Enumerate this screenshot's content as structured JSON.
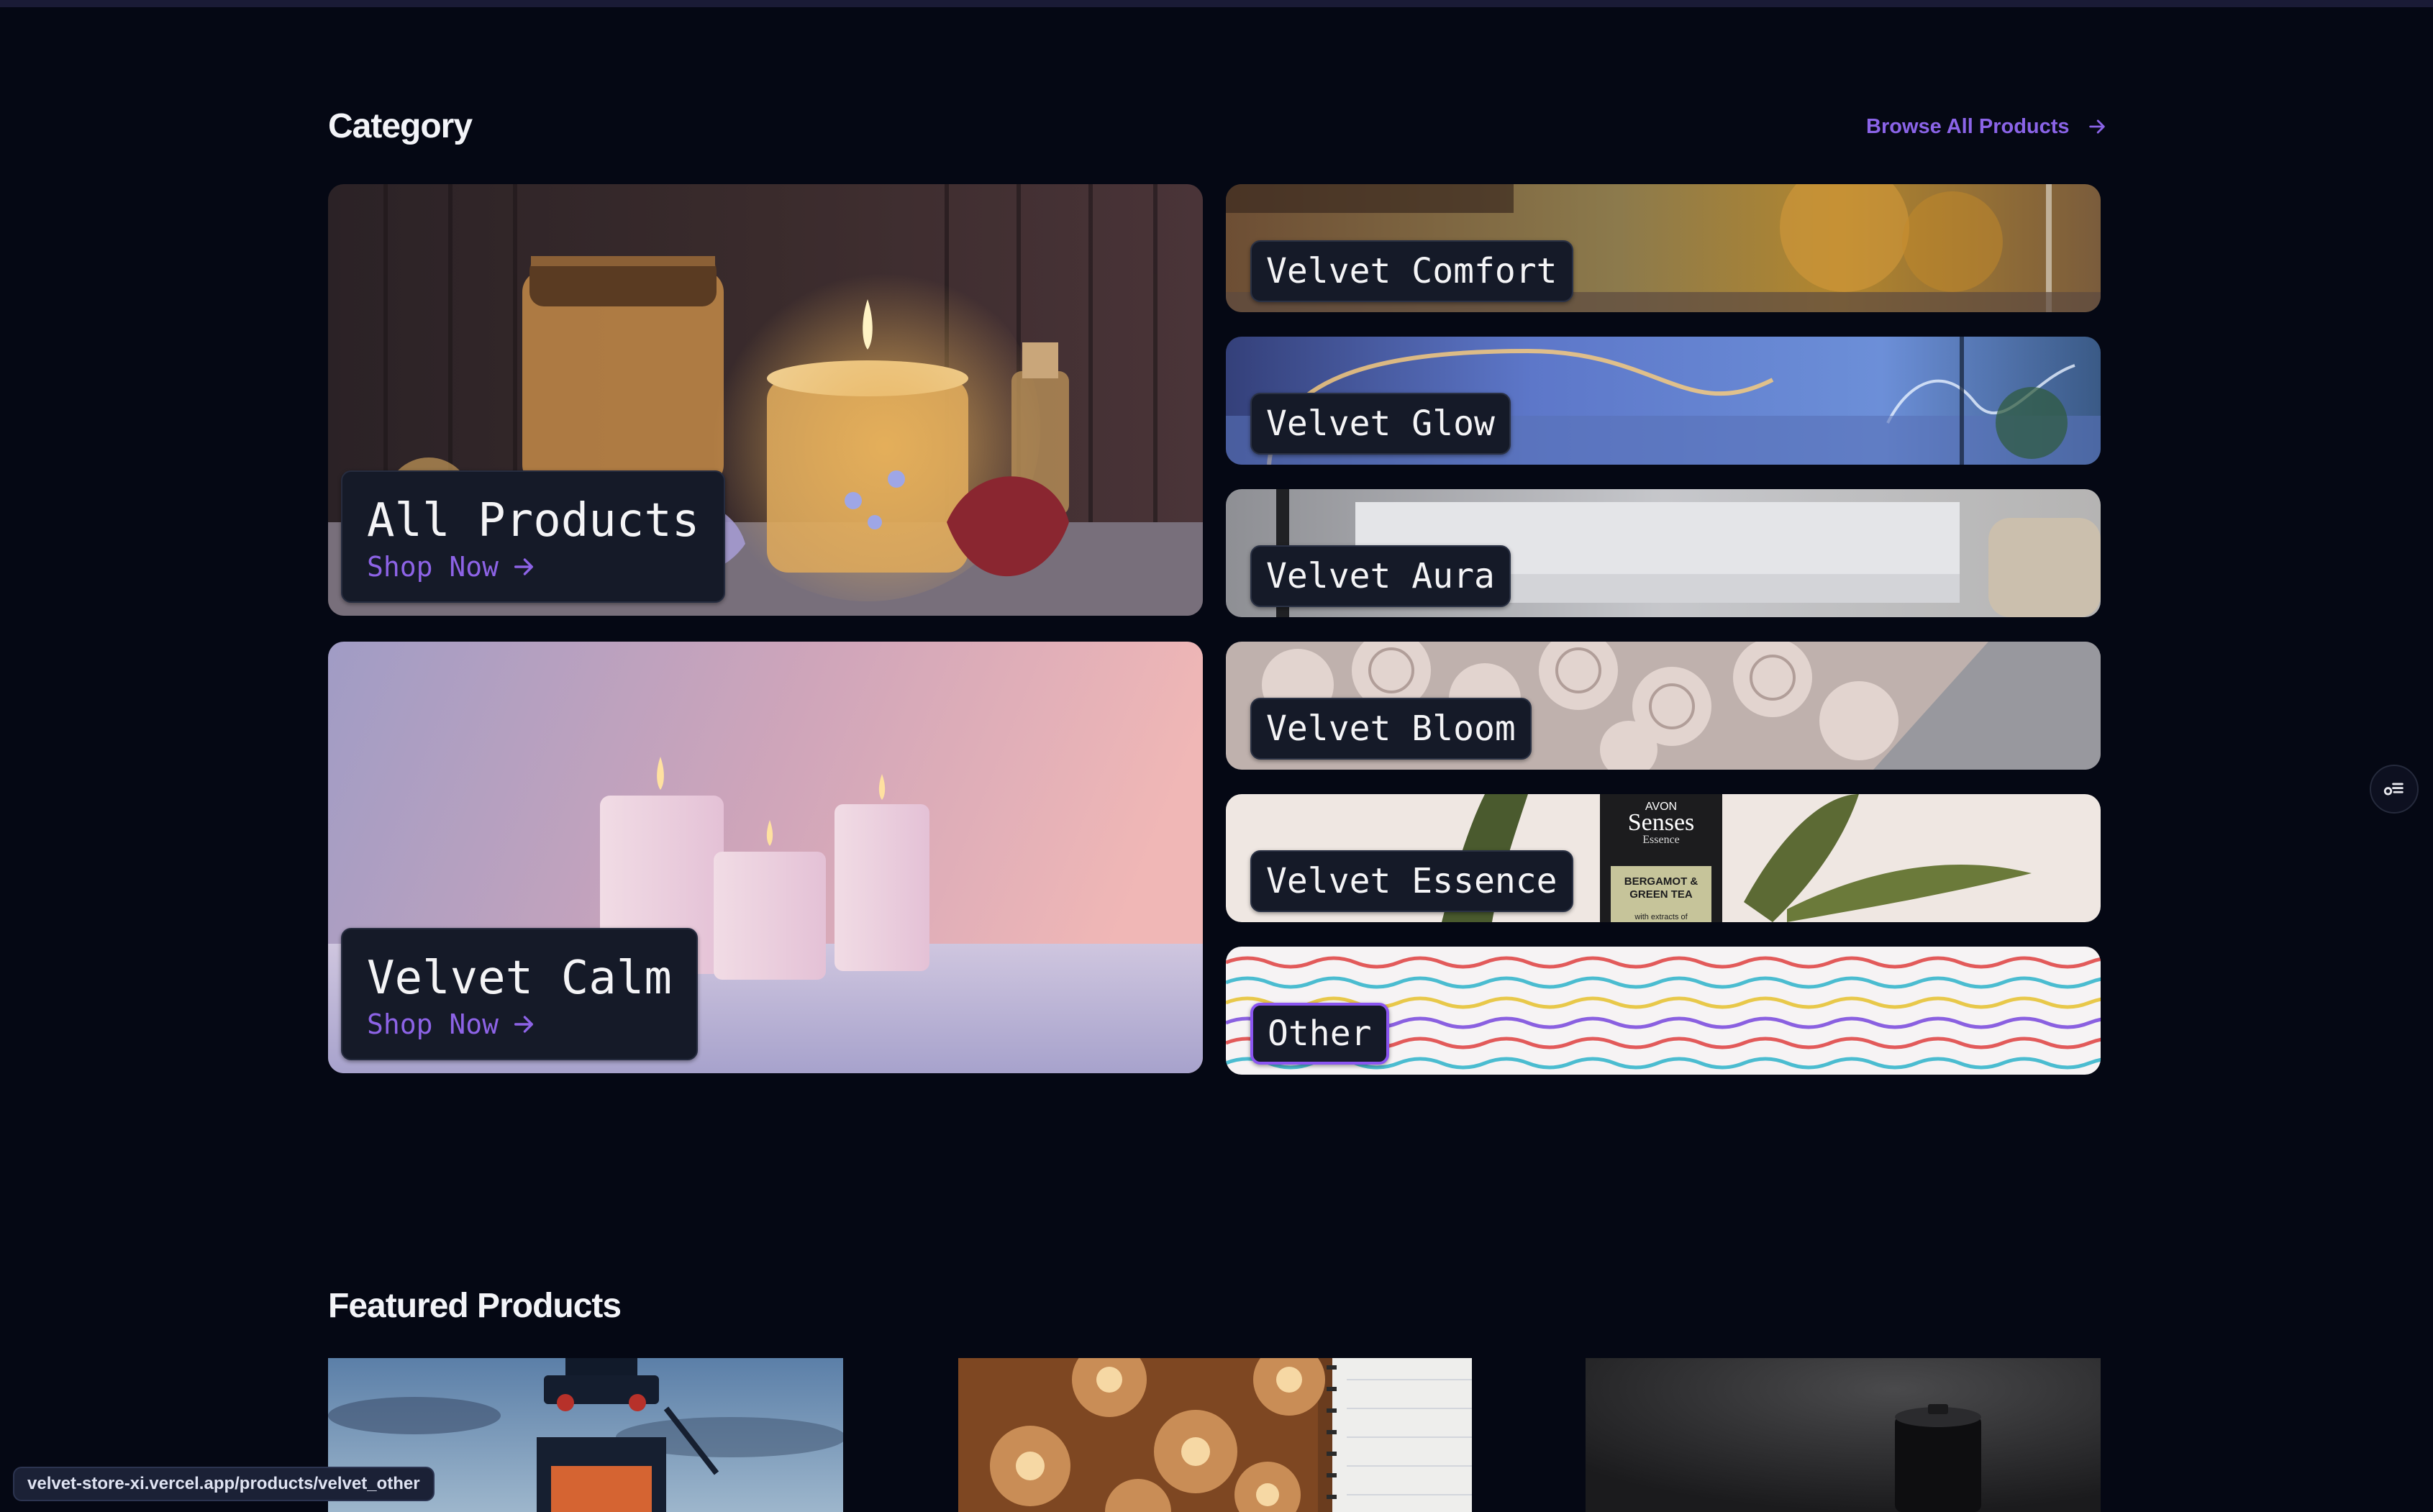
{
  "category_section": {
    "title": "Category",
    "browse_link": "Browse All Products",
    "large_cards": [
      {
        "name": "All Products",
        "cta": "Shop Now"
      },
      {
        "name": "Velvet Calm",
        "cta": "Shop Now"
      }
    ],
    "small_cards": [
      {
        "name": "Velvet Comfort"
      },
      {
        "name": "Velvet Glow"
      },
      {
        "name": "Velvet Aura"
      },
      {
        "name": "Velvet Bloom"
      },
      {
        "name": "Velvet Essence"
      },
      {
        "name": "Other"
      }
    ],
    "essence_product_text": {
      "brand": "AVON",
      "line": "Senses",
      "sub": "Essence",
      "flavor1": "BERGAMOT &",
      "flavor2": "GREEN TEA",
      "extra": "with extracts of"
    }
  },
  "featured_section": {
    "title": "Featured Products"
  },
  "status_bar": {
    "url": "velvet-store-xi.vercel.app/products/velvet_other"
  },
  "colors": {
    "background": "#050814",
    "accent": "#8b64e8",
    "label_bg": "#151a28"
  },
  "icons": {
    "browse_arrow": "arrow-right-icon",
    "shop_arrow": "arrow-right-icon",
    "side_widget": "toggle-list-icon"
  }
}
